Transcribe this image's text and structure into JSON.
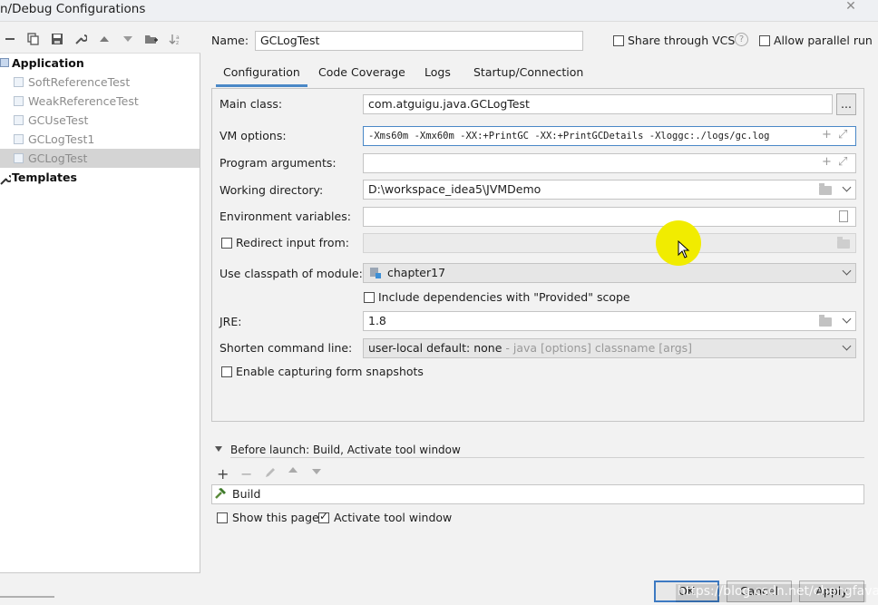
{
  "window": {
    "title": "n/Debug Configurations",
    "close": "✕"
  },
  "toolbar": {
    "icons": [
      "minus-icon",
      "copy-icon",
      "save-icon",
      "wrench-icon",
      "move-up-icon",
      "move-down-icon",
      "folder-add-icon",
      "sort-icon"
    ]
  },
  "tree": {
    "group_application": "Application",
    "items": [
      "SoftReferenceTest",
      "WeakReferenceTest",
      "GCUseTest",
      "GCLogTest1",
      "GCLogTest"
    ],
    "group_templates": "Templates"
  },
  "header": {
    "name_label": "Name:",
    "name_value": "GCLogTest",
    "share_vcs": "Share through VCS",
    "help": "?",
    "allow_parallel": "Allow parallel run"
  },
  "tabs": [
    "Configuration",
    "Code Coverage",
    "Logs",
    "Startup/Connection"
  ],
  "form": {
    "main_class_label": "Main class:",
    "main_class_value": "com.atguigu.java.GCLogTest",
    "browse": "...",
    "vm_options_label": "VM options:",
    "vm_options_value": "-Xms60m -Xmx60m -XX:+PrintGC -XX:+PrintGCDetails -Xloggc:./logs/gc.log",
    "program_args_label": "Program arguments:",
    "working_dir_label": "Working directory:",
    "working_dir_value": "D:\\workspace_idea5\\JVMDemo",
    "env_vars_label": "Environment variables:",
    "redirect_label": "Redirect input from:",
    "classpath_label": "Use classpath of module:",
    "classpath_value": "chapter17",
    "include_deps_label": "Include dependencies with \"Provided\" scope",
    "jre_label": "JRE:",
    "jre_value": "1.8",
    "shorten_label": "Shorten command line:",
    "shorten_value": "user-local default: none",
    "shorten_hint": " - java [options] classname [args]",
    "snapshots_label": "Enable capturing form snapshots"
  },
  "before_launch": {
    "title": "Before launch: Build, Activate tool window",
    "item": "Build",
    "show_page": "Show this page",
    "activate_tool": "Activate tool window"
  },
  "buttons": {
    "ok": "OK",
    "cancel": "Cancel",
    "apply": "Apply"
  },
  "watermark": "https://blog.csdn.net/chengfava",
  "colors": {
    "accent": "#4a88c7",
    "selection": "#d4d4d4",
    "cursor_highlight": "#f1ec00"
  }
}
